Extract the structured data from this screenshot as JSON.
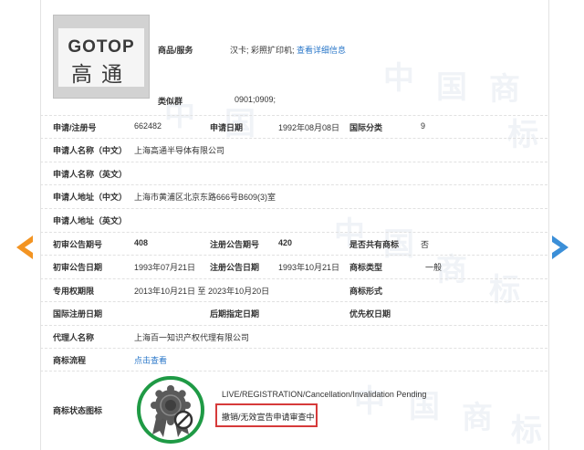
{
  "logo": {
    "text_en": "GOTOP",
    "text_cn": "高通"
  },
  "goods": {
    "label": "商品/服务",
    "value": "汉卡; 彩照扩印机;",
    "link": "查看详细信息"
  },
  "similar_group": {
    "label": "类似群",
    "value": "0901;0909;"
  },
  "reg_no": {
    "label": "申请/注册号",
    "value": "662482"
  },
  "app_date": {
    "label": "申请日期",
    "value": "1992年08月08日"
  },
  "intl_class": {
    "label": "国际分类",
    "value": "9"
  },
  "applicant_cn": {
    "label": "申请人名称（中文）",
    "value": "上海高通半导体有限公司"
  },
  "applicant_en": {
    "label": "申请人名称（英文）",
    "value": ""
  },
  "address_cn": {
    "label": "申请人地址（中文）",
    "value": "上海市黄浦区北京东路666号B609(3)室"
  },
  "address_en": {
    "label": "申请人地址（英文）",
    "value": ""
  },
  "prelim_issue": {
    "label": "初审公告期号",
    "value": "408"
  },
  "reg_issue": {
    "label": "注册公告期号",
    "value": "420"
  },
  "shared": {
    "label": "是否共有商标",
    "value": "否"
  },
  "prelim_date": {
    "label": "初审公告日期",
    "value": "1993年07月21日"
  },
  "reg_date": {
    "label": "注册公告日期",
    "value": "1993年10月21日"
  },
  "mark_type": {
    "label": "商标类型",
    "value": "一般"
  },
  "exclusive": {
    "label": "专用权期限",
    "value": "2013年10月21日 至 2023年10月20日"
  },
  "mark_form": {
    "label": "商标形式",
    "value": ""
  },
  "intl_reg_date": {
    "label": "国际注册日期",
    "value": ""
  },
  "later_date": {
    "label": "后期指定日期",
    "value": ""
  },
  "priority_date": {
    "label": "优先权日期",
    "value": ""
  },
  "agent": {
    "label": "代理人名称",
    "value": "上海百一知识产权代理有限公司"
  },
  "process": {
    "label": "商标流程",
    "link": "点击查看"
  },
  "status": {
    "label": "商标状态图标",
    "en": "LIVE/REGISTRATION/Cancellation/Invalidation Pending",
    "cn": "撤销/无效宣告申请审查中"
  },
  "watermark": [
    "中",
    "国",
    "商",
    "标"
  ],
  "colors": {
    "accent_orange": "#f39422",
    "accent_blue": "#3b8fd8",
    "link": "#2a77c9",
    "seal_green": "#1f9a45",
    "highlight_red": "#d63a3a"
  },
  "icons": {
    "prev": "chevron-left-icon",
    "next": "chevron-right-icon",
    "status": "seal-prohibited-icon"
  }
}
